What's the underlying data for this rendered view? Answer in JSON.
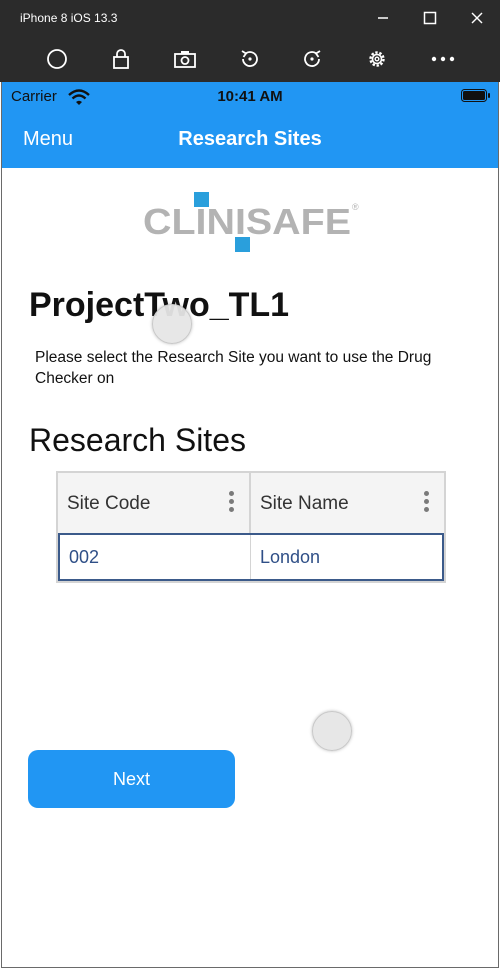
{
  "window": {
    "title": "iPhone 8 iOS 13.3",
    "controls": [
      "minimize-icon",
      "maximize-icon",
      "close-icon"
    ]
  },
  "toolbar": {
    "icons": [
      "home-circle-icon",
      "lock-icon",
      "camera-icon",
      "rotate-left-icon",
      "rotate-right-icon",
      "gear-icon",
      "more-icon"
    ]
  },
  "status_bar": {
    "carrier": "Carrier",
    "time": "10:41 AM",
    "battery": "full"
  },
  "nav": {
    "menu_label": "Menu",
    "title": "Research Sites"
  },
  "logo": {
    "text": "CLINISAFE",
    "mark": "®",
    "colors": {
      "text": "#b3b3b3",
      "squares": "#2a9fdc"
    }
  },
  "project": {
    "title": "ProjectTwo_TL1",
    "instruction": "Please select the Research Site you want to use the Drug Checker on"
  },
  "sites": {
    "section_title": "Research Sites",
    "columns": [
      "Site Code",
      "Site Name"
    ],
    "rows": [
      {
        "code": "002",
        "name": "London"
      }
    ]
  },
  "next_button": {
    "label": "Next"
  },
  "colors": {
    "accent": "#2196f3",
    "chrome": "#2b2b2b",
    "grid_border": "#d4d4d4",
    "row_text": "#2f4f87"
  }
}
